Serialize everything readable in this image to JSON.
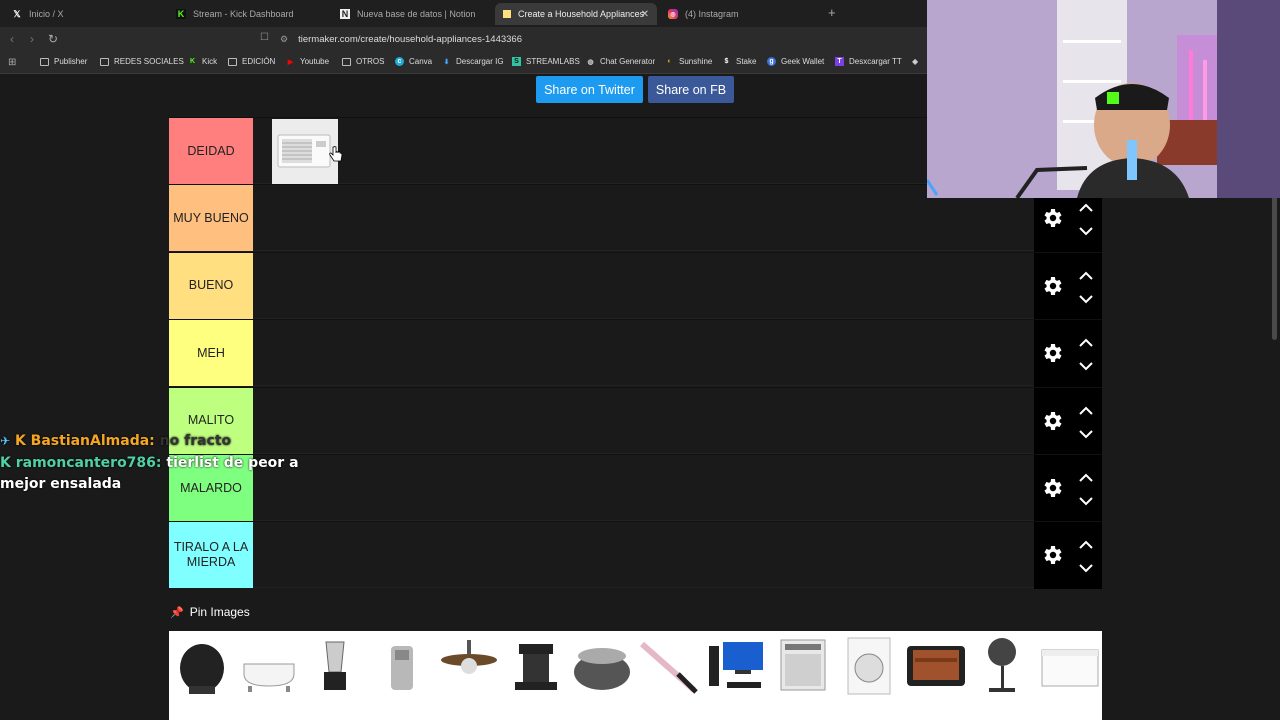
{
  "browser": {
    "tabs": [
      {
        "label": "Inicio / X",
        "icon": "x-logo-icon"
      },
      {
        "label": "Stream - Kick Dashboard",
        "icon": "kick-logo-icon"
      },
      {
        "label": "Nueva base de datos | Notion",
        "icon": "notion-logo-icon"
      },
      {
        "label": "Create a Household Appliances",
        "icon": "tiermaker-icon",
        "active": true
      },
      {
        "label": "(4) Instagram",
        "icon": "instagram-icon"
      }
    ],
    "new_tab": "+",
    "url": "tiermaker.com/create/household-appliances-1443366",
    "bookmarks": [
      {
        "label": "Publisher",
        "icon": "folder-icon"
      },
      {
        "label": "REDES SOCIALES",
        "icon": "folder-icon"
      },
      {
        "label": "Kick",
        "icon": "kick-logo-icon"
      },
      {
        "label": "EDICIÓN",
        "icon": "folder-icon"
      },
      {
        "label": "Youtube",
        "icon": "youtube-icon"
      },
      {
        "label": "OTROS",
        "icon": "folder-icon"
      },
      {
        "label": "Canva",
        "icon": "canva-icon"
      },
      {
        "label": "Descargar IG",
        "icon": "download-icon"
      },
      {
        "label": "STREAMLABS",
        "icon": "streamlabs-icon"
      },
      {
        "label": "Chat Generator",
        "icon": "globe-icon"
      },
      {
        "label": "Sunshine",
        "icon": "sun-icon"
      },
      {
        "label": "Stake",
        "icon": "stake-icon"
      },
      {
        "label": "Geek Wallet",
        "icon": "wallet-icon"
      },
      {
        "label": "Desxcargar TT",
        "icon": "tiktok-icon"
      }
    ]
  },
  "share": {
    "twitter": "Share on Twitter",
    "fb": "Share on FB"
  },
  "tiers": [
    {
      "label": "DEIDAD",
      "color": "#ff7f7f"
    },
    {
      "label": "MUY BUENO",
      "color": "#ffbf7f"
    },
    {
      "label": "BUENO",
      "color": "#ffdf7f"
    },
    {
      "label": "MEH",
      "color": "#ffff7f"
    },
    {
      "label": "MALITO",
      "color": "#bfff7f"
    },
    {
      "label": "MALARDO",
      "color": "#7fff7f"
    },
    {
      "label": "TIRALO A LA MIERDA",
      "color": "#7fffff"
    }
  ],
  "chat": [
    {
      "user": "BastianAlmada:",
      "message": "no fracto",
      "platform_icon": "kick-logo-icon"
    },
    {
      "user": "ramoncantero786:",
      "message": "tierlist de peor a",
      "continuation": "mejor ensalada",
      "platform_icon": "kick-logo-icon"
    }
  ],
  "pin_images": "Pin Images",
  "pool_items": [
    "air-fryer",
    "bathtub",
    "blender",
    "can-opener",
    "ceiling-fan",
    "coffee-maker",
    "slow-cooker",
    "curling-iron",
    "desktop-pc",
    "dishwasher",
    "washing-machine",
    "griddle",
    "standing-fan",
    "chest-freezer"
  ]
}
